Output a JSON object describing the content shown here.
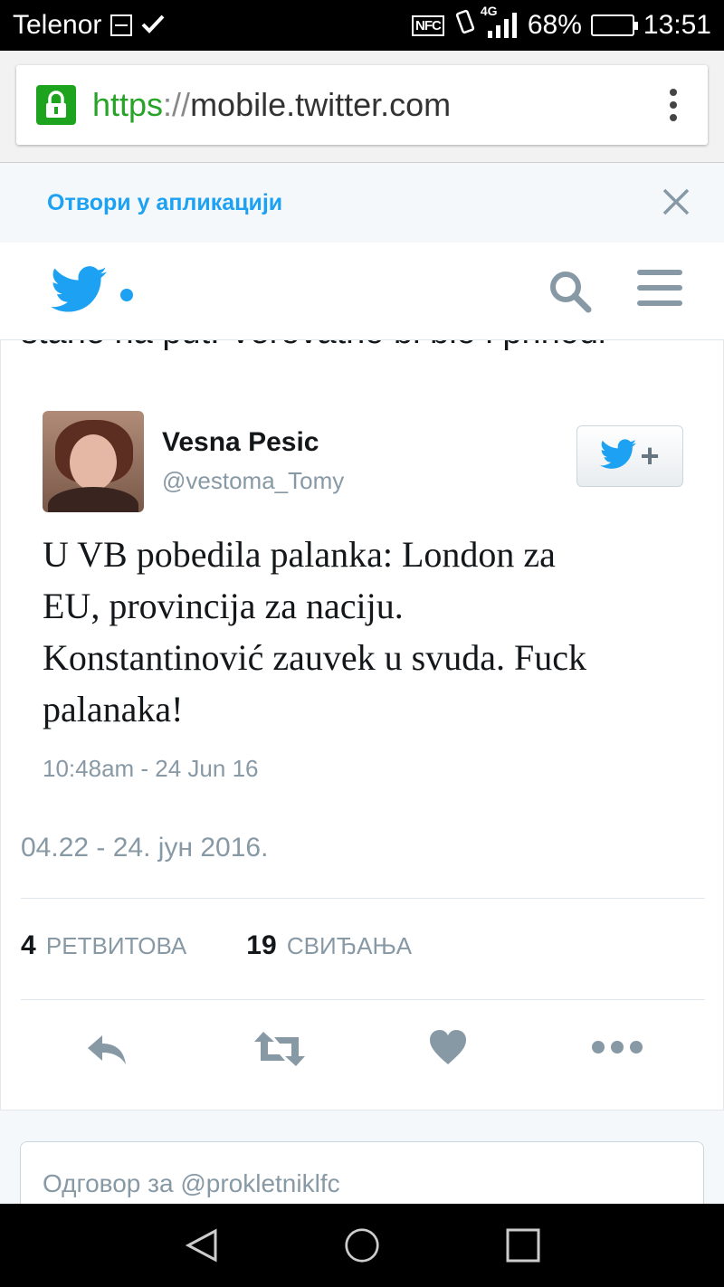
{
  "status_bar": {
    "carrier": "Telenor",
    "network": "4G",
    "battery": "68%",
    "battery_level": 0.68,
    "time": "13:51"
  },
  "browser": {
    "url_scheme": "https",
    "url_separator": "://",
    "url_host": "mobile.twitter.com"
  },
  "open_in_app": {
    "label": "Отвори у апликацији"
  },
  "content": {
    "cut_off_text": "stane na put. Verovatno bi bio i prihodi"
  },
  "tweet": {
    "author_name": "Vesna Pesic",
    "author_handle": "@vestoma_Tomy",
    "text_lines": [
      "U VB pobedila palanka: London za",
      "EU, provincija za naciju.",
      "Konstantinović zauvek u svuda. Fuck",
      "palanaka!"
    ],
    "time": "10:48am - 24 Jun 16"
  },
  "retweet_meta": {
    "date": "04.22 - 24. јун 2016."
  },
  "stats": {
    "retweets_count": "4",
    "retweets_label": "РЕТВИТОВА",
    "likes_count": "19",
    "likes_label": "СВИЂАЊА"
  },
  "reply": {
    "placeholder": "Одговор за @prokletniklfc"
  },
  "colors": {
    "twitter_blue": "#1da1f2",
    "icon_gray": "#8899a6",
    "text_dark": "#14171a",
    "lock_green": "#1ea31e"
  }
}
